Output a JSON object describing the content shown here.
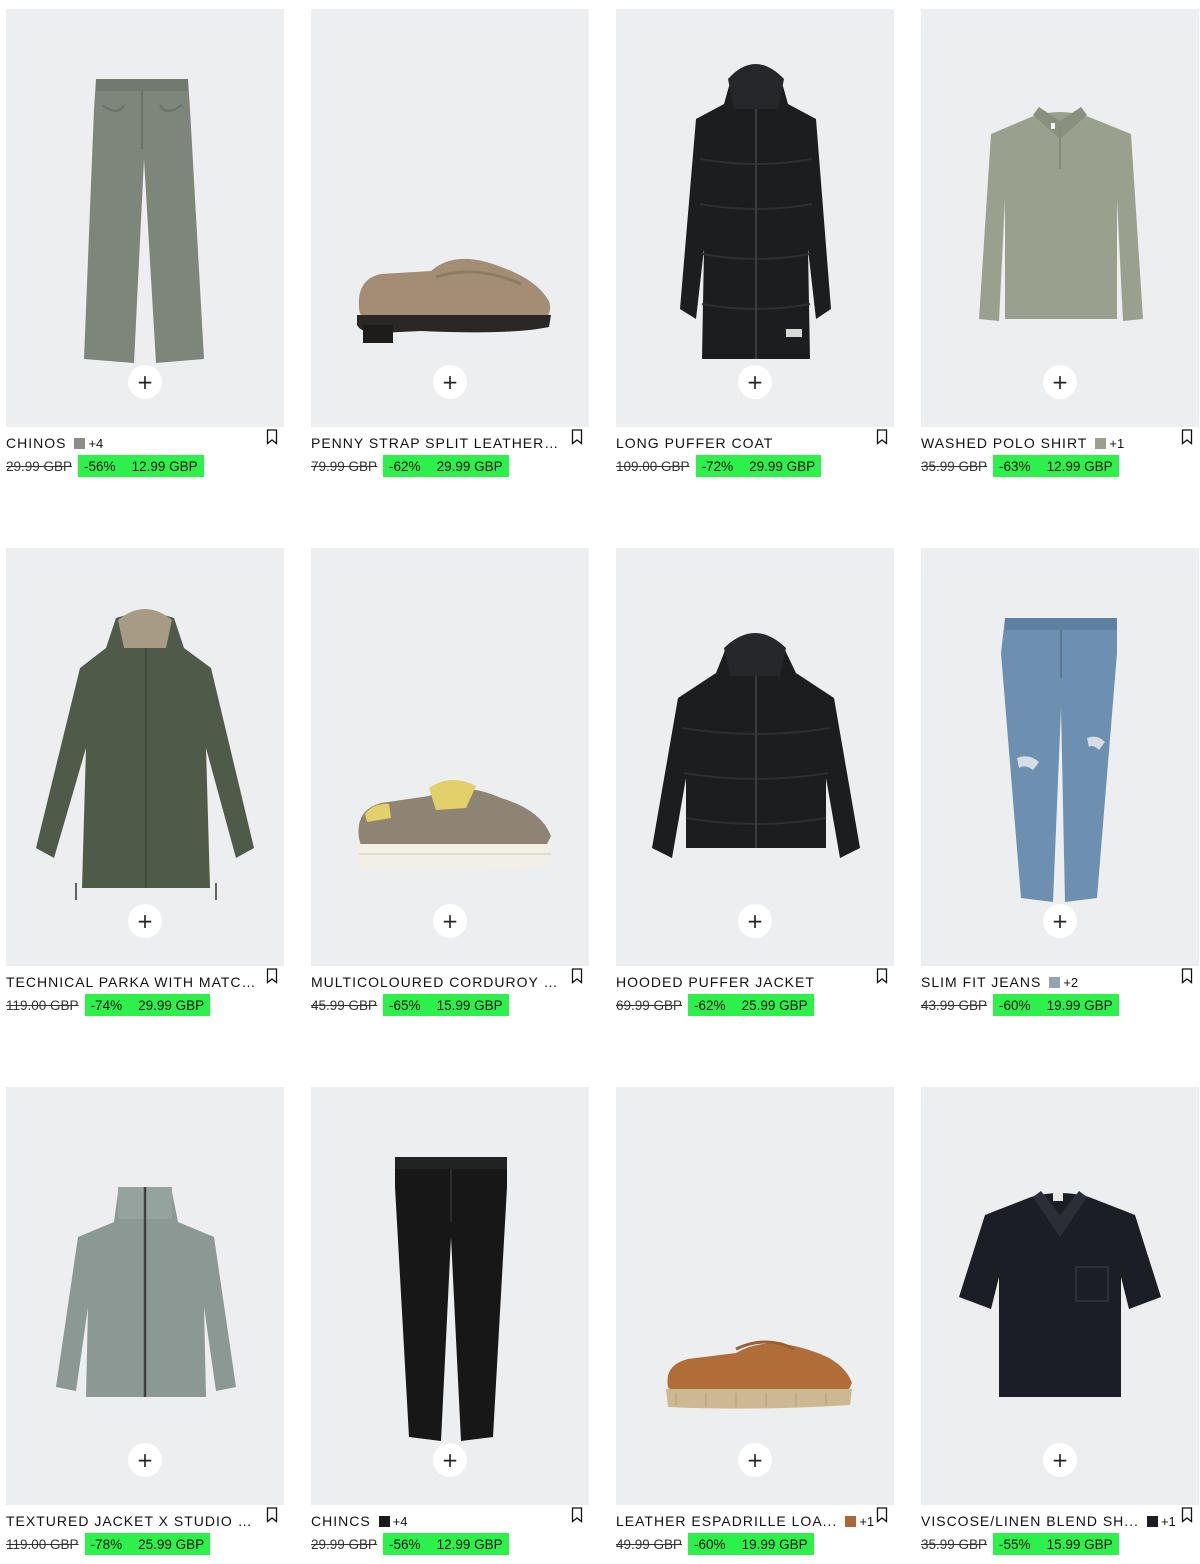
{
  "theme": {
    "sale_highlight": "#2ef04a",
    "image_bg": "#eceef0"
  },
  "add_label": "+",
  "products": [
    {
      "title": "CHINOS",
      "swatch": "#8b8d88",
      "more_colors": "+4",
      "old_price": "29.99 GBP",
      "discount": "-56%",
      "price": "12.99 GBP",
      "image": "chinos-grey"
    },
    {
      "title": "PENNY STRAP SPLIT LEATHER L...",
      "old_price": "79.99 GBP",
      "discount": "-62%",
      "price": "29.99 GBP",
      "image": "loafer-taupe"
    },
    {
      "title": "LONG PUFFER COAT",
      "old_price": "109.00 GBP",
      "discount": "-72%",
      "price": "29.99 GBP",
      "image": "long-puffer"
    },
    {
      "title": "WASHED POLO SHIRT",
      "swatch": "#9aa08e",
      "more_colors": "+1",
      "old_price": "35.99 GBP",
      "discount": "-63%",
      "price": "12.99 GBP",
      "image": "polo-sage"
    },
    {
      "title": "TECHNICAL PARKA WITH MATCH...",
      "old_price": "119.00 GBP",
      "discount": "-74%",
      "price": "29.99 GBP",
      "image": "parka-khaki"
    },
    {
      "title": "MULTICOLOURED CORDUROY S...",
      "old_price": "45.99 GBP",
      "discount": "-65%",
      "price": "15.99 GBP",
      "image": "sneaker-corduroy"
    },
    {
      "title": "HOODED PUFFER JACKET",
      "old_price": "69.99 GBP",
      "discount": "-62%",
      "price": "25.99 GBP",
      "image": "short-puffer"
    },
    {
      "title": "SLIM FIT JEANS",
      "swatch": "#8fa3b3",
      "more_colors": "+2",
      "old_price": "43.99 GBP",
      "discount": "-60%",
      "price": "19.99 GBP",
      "image": "jeans-blue"
    },
    {
      "title": "TEXTURED JACKET X STUDIO NI...",
      "old_price": "119.00 GBP",
      "discount": "-78%",
      "price": "25.99 GBP",
      "image": "jacket-grey"
    },
    {
      "title": "CHINCS",
      "swatch": "#1a1a1a",
      "more_colors": "+4",
      "old_price": "29.99 GBP",
      "discount": "-56%",
      "price": "12.99 GBP",
      "image": "chinos-black"
    },
    {
      "title": "LEATHER ESPADRILLE LOA...",
      "swatch": "#a8683a",
      "more_colors": "+1",
      "old_price": "49.99 GBP",
      "discount": "-60%",
      "price": "19.99 GBP",
      "image": "espadrille-tan"
    },
    {
      "title": "VISCOSE/LINEN BLEND SH...",
      "swatch": "#1b1e24",
      "more_colors": "+1",
      "old_price": "35.99 GBP",
      "discount": "-55%",
      "price": "15.99 GBP",
      "image": "shirt-navy"
    }
  ]
}
